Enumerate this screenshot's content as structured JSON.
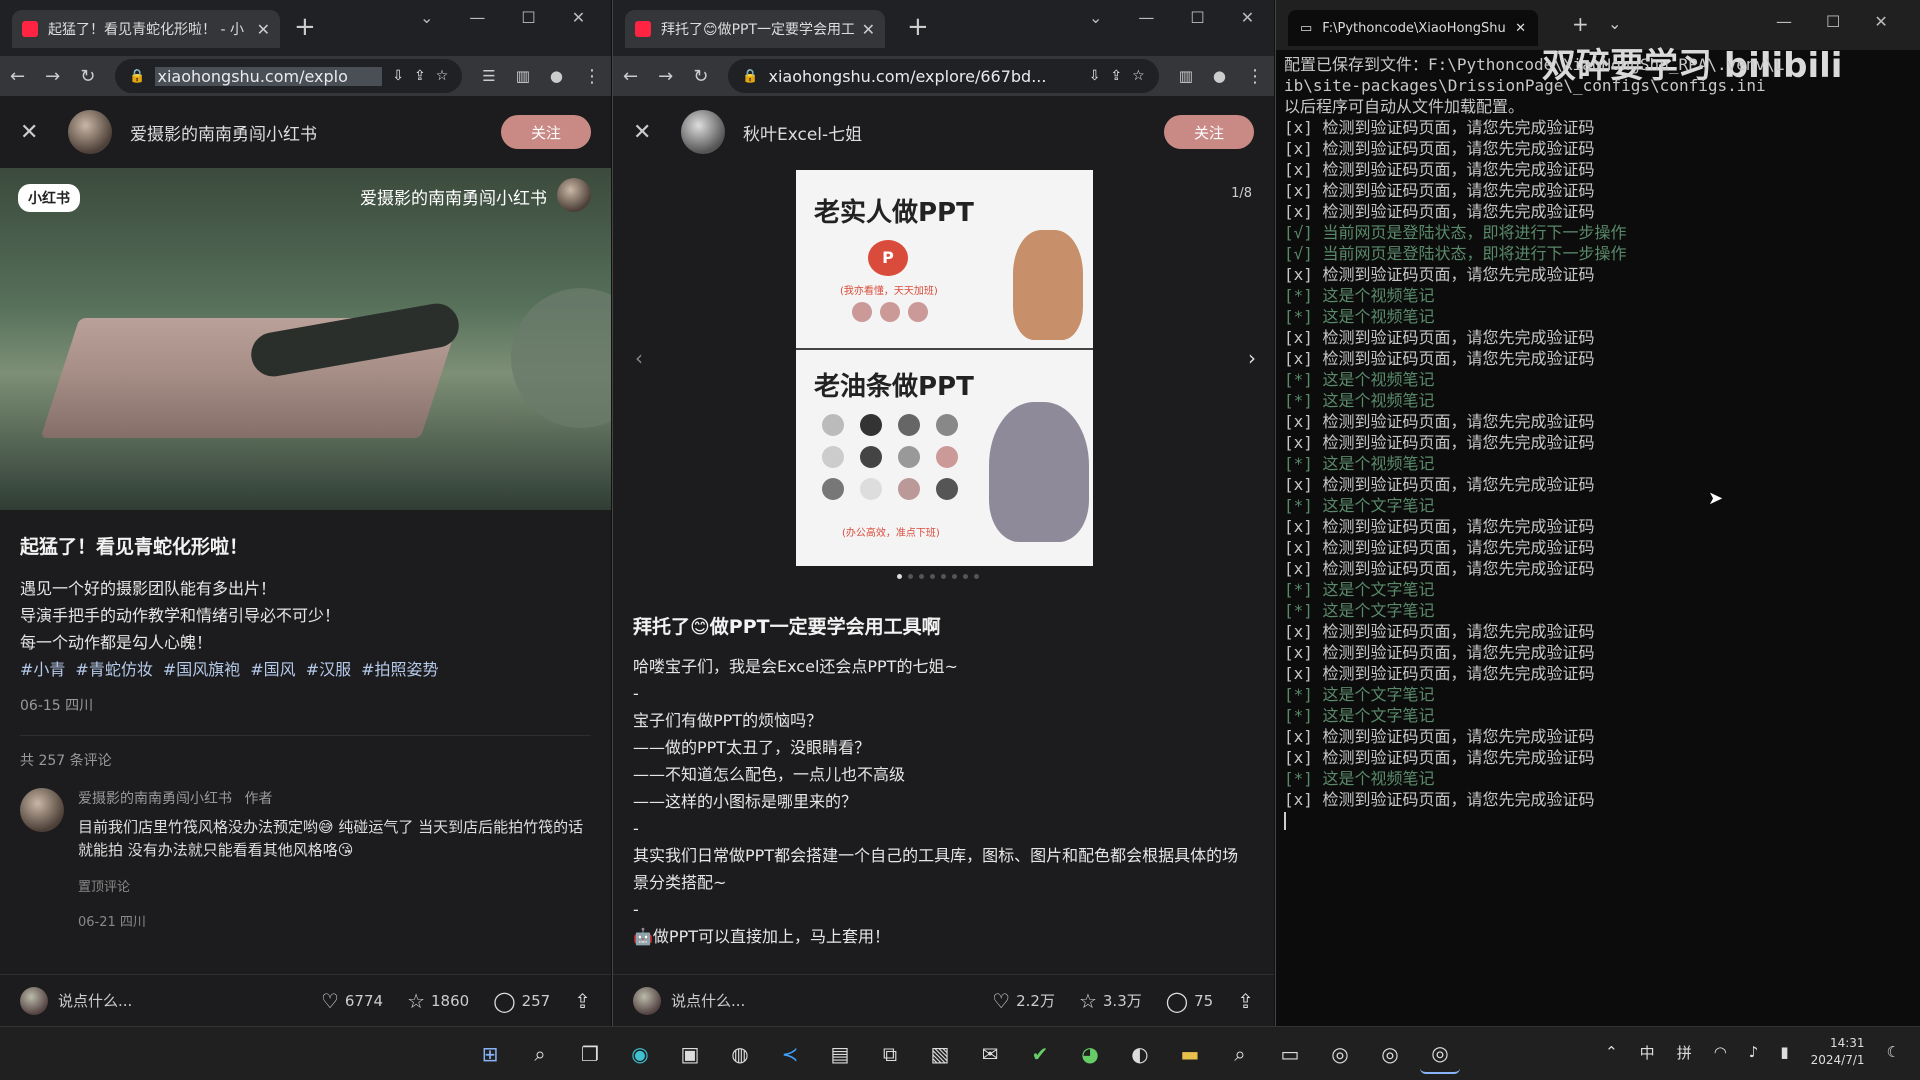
{
  "watermark": "双碎要学习 bilibili",
  "left": {
    "tab_title": "起猛了！看见青蛇化形啦！ - 小",
    "url": "xiaohongshu.com/explo",
    "author": "爱摄影的南南勇闯小红书",
    "follow": "关注",
    "image_badge": "小红书",
    "image_author": "爱摄影的南南勇闯小红书",
    "title": "起猛了！看见青蛇化形啦！",
    "body": [
      "遇见一个好的摄影团队能有多出片！",
      "导演手把手的动作教学和情绪引导必不可少！",
      "每一个动作都是勾人心魄！"
    ],
    "tags": [
      "#小青",
      "#青蛇仿妆",
      "#国风旗袍",
      "#国风",
      "#汉服",
      "#拍照姿势"
    ],
    "date": "06-15 四川",
    "comment_count": "共 257 条评论",
    "comment": {
      "user": "爱摄影的南南勇闯小红书",
      "role": "作者",
      "text": "目前我们店里竹筏风格没办法预定哟😅 纯碰运气了 当天到店后能拍竹筏的话就能拍 没有办法就只能看看其他风格咯😘",
      "pinned": "置顶评论",
      "date": "06-21 四川"
    },
    "placeholder": "说点什么...",
    "likes": "6774",
    "stars": "1860",
    "comments": "257"
  },
  "middle": {
    "tab_title": "拜托了😊做PPT一定要学会用工",
    "url": "xiaohongshu.com/explore/667bd...",
    "author": "秋叶Excel-七姐",
    "follow": "关注",
    "page_indicator": "1/8",
    "slide_top_title": "老实人做PPT",
    "slide_top_caption": "(我亦看懂，天天加班)",
    "slide_bottom_title": "老油条做PPT",
    "slide_bottom_caption": "(办公高效，准点下班)",
    "title": "拜托了😊做PPT一定要学会用工具啊",
    "body": [
      "哈喽宝子们，我是会Excel还会点PPT的七姐~",
      "-",
      "宝子们有做PPT的烦恼吗？",
      "——做的PPT太丑了，没眼睛看？",
      "——不知道怎么配色，一点儿也不高级",
      "——这样的小图标是哪里来的？",
      "-",
      "其实我们日常做PPT都会搭建一个自己的工具库，图标、图片和配色都会根据具体的场景分类搭配~",
      "-",
      "🤖做PPT可以直接加上，马上套用！"
    ],
    "placeholder": "说点什么...",
    "likes": "2.2万",
    "stars": "3.3万",
    "comments": "75"
  },
  "terminal": {
    "tab_title": "F:\\Pythoncode\\XiaoHongShu_",
    "lines": [
      "配置已保存到文件：F:\\Pythoncode\\XiaoHongShu_RPA\\.venv\\L",
      "ib\\site-packages\\DrissionPage\\_configs\\configs.ini",
      "以后程序可自动从文件加载配置。",
      "[x] 检测到验证码页面，请您先完成验证码",
      "[x] 检测到验证码页面，请您先完成验证码",
      "[x] 检测到验证码页面，请您先完成验证码",
      "[x] 检测到验证码页面，请您先完成验证码",
      "[x] 检测到验证码页面，请您先完成验证码",
      "[√] 当前网页是登陆状态，即将进行下一步操作",
      "[√] 当前网页是登陆状态，即将进行下一步操作",
      "[x] 检测到验证码页面，请您先完成验证码",
      "[*] 这是个视频笔记",
      "[*] 这是个视频笔记",
      "[x] 检测到验证码页面，请您先完成验证码",
      "[x] 检测到验证码页面，请您先完成验证码",
      "[*] 这是个视频笔记",
      "[*] 这是个视频笔记",
      "[x] 检测到验证码页面，请您先完成验证码",
      "[x] 检测到验证码页面，请您先完成验证码",
      "[*] 这是个视频笔记",
      "[x] 检测到验证码页面，请您先完成验证码",
      "[*] 这是个文字笔记",
      "[x] 检测到验证码页面，请您先完成验证码",
      "[x] 检测到验证码页面，请您先完成验证码",
      "[x] 检测到验证码页面，请您先完成验证码",
      "[*] 这是个文字笔记",
      "[*] 这是个文字笔记",
      "[x] 检测到验证码页面，请您先完成验证码",
      "[x] 检测到验证码页面，请您先完成验证码",
      "[x] 检测到验证码页面，请您先完成验证码",
      "[*] 这是个文字笔记",
      "[*] 这是个文字笔记",
      "[x] 检测到验证码页面，请您先完成验证码",
      "[x] 检测到验证码页面，请您先完成验证码",
      "[*] 这是个视频笔记",
      "[x] 检测到验证码页面，请您先完成验证码"
    ]
  },
  "taskbar": {
    "ime1": "中",
    "ime2": "拼",
    "time": "14:31",
    "date": "2024/7/1"
  }
}
